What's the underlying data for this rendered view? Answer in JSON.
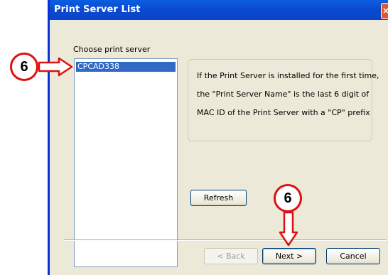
{
  "window": {
    "title": "Print Server List",
    "close_glyph": "×"
  },
  "main": {
    "list_label": "Choose print server",
    "list_items": [
      "CPCAD338"
    ],
    "info_lines": [
      "If the Print Server is installed for the first time,",
      "the \"Print Server Name\" is the last 6 digit of",
      "MAC ID of the Print Server with a \"CP\" prefix"
    ],
    "refresh_label": "Refresh"
  },
  "footer": {
    "back_label": "< Back",
    "next_label": "Next >",
    "cancel_label": "Cancel"
  },
  "callouts": [
    {
      "label": "6",
      "target": "list-item-cpcad338"
    },
    {
      "label": "6",
      "target": "next-button"
    }
  ],
  "colors": {
    "callout_red": "#dd1111",
    "titlebar_blue": "#0a5fe0",
    "selection_blue": "#316ac5",
    "dialog_bg": "#ece9d8"
  }
}
